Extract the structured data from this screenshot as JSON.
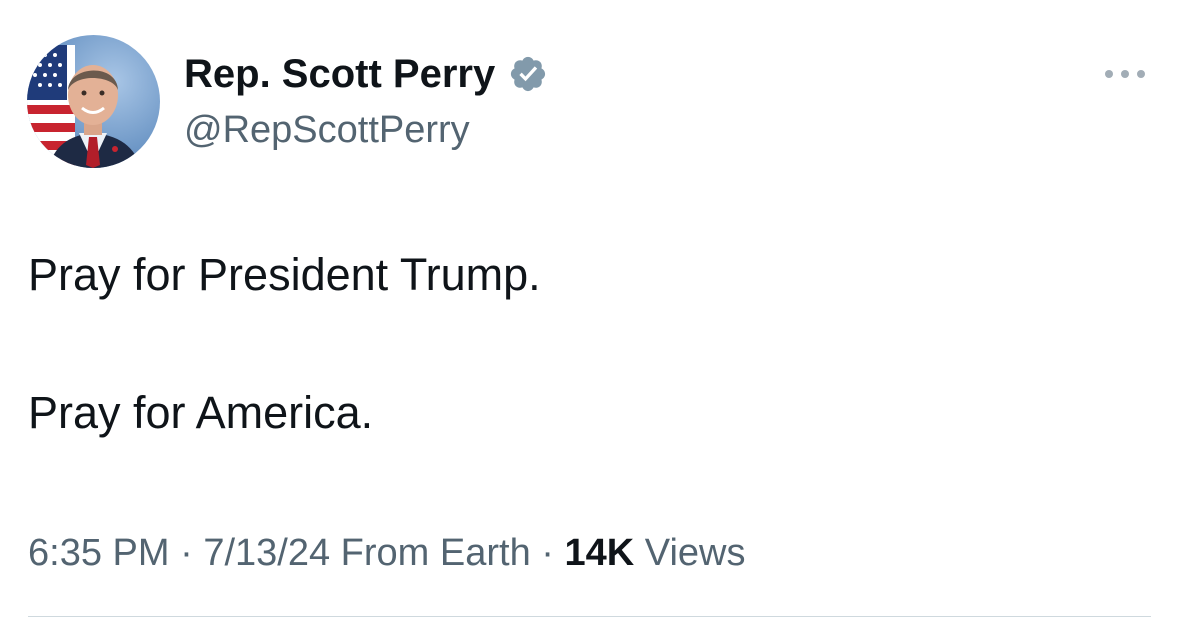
{
  "author": {
    "display_name": "Rep. Scott Perry",
    "handle": "@RepScottPerry",
    "verified": true,
    "verified_badge_color": "#829aab",
    "avatar_icon": "profile-photo-avatar"
  },
  "tweet": {
    "lines": [
      "Pray for President Trump.",
      "Pray for America."
    ]
  },
  "meta": {
    "time": "6:35 PM",
    "separator": "·",
    "date": "7/13/24",
    "source": "From Earth",
    "views_count": "14K",
    "views_label": "Views"
  },
  "icons": {
    "more": "more-horizontal-icon",
    "verified": "verified-badge-icon"
  },
  "colors": {
    "text_primary": "#0f1419",
    "text_secondary": "#536471",
    "divider": "#cfd9de"
  }
}
